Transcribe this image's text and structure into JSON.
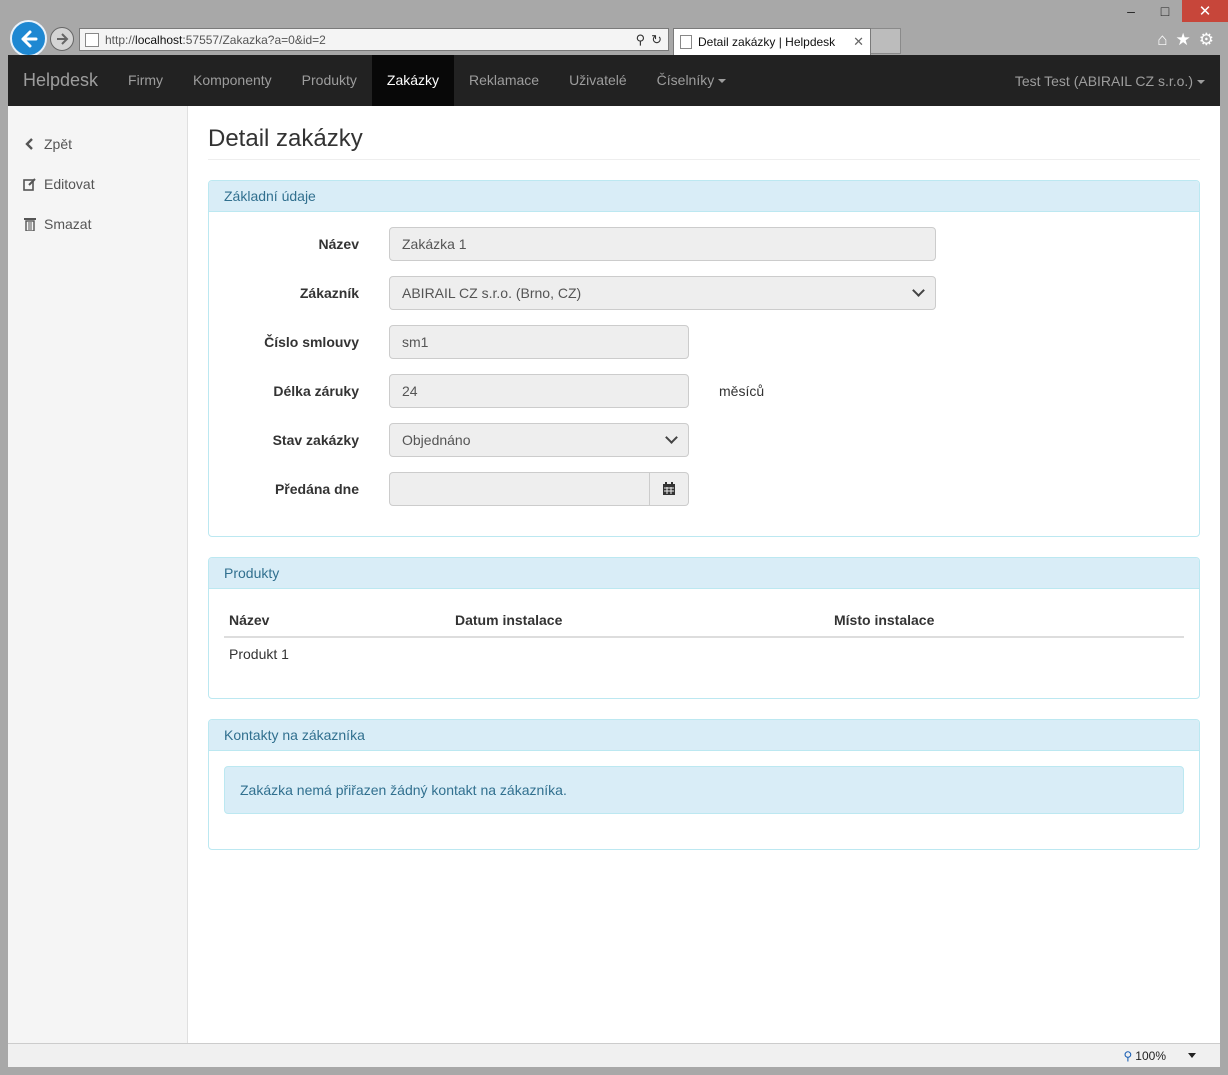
{
  "browser": {
    "url_prefix": "http://",
    "url_host": "localhost",
    "url_rest": ":57557/Zakazka?a=0&id=2",
    "tab_title": "Detail zakázky | Helpdesk",
    "zoom": "100%"
  },
  "navbar": {
    "brand": "Helpdesk",
    "items": [
      {
        "label": "Firmy"
      },
      {
        "label": "Komponenty"
      },
      {
        "label": "Produkty"
      },
      {
        "label": "Zakázky",
        "active": true
      },
      {
        "label": "Reklamace"
      },
      {
        "label": "Uživatelé"
      },
      {
        "label": "Číselníky"
      }
    ],
    "user": "Test Test (ABIRAIL CZ s.r.o.)"
  },
  "sidebar": {
    "back": "Zpět",
    "edit": "Editovat",
    "delete": "Smazat"
  },
  "page": {
    "title": "Detail zakázky"
  },
  "basic": {
    "heading": "Základní údaje",
    "name_label": "Název",
    "name_value": "Zakázka 1",
    "customer_label": "Zákazník",
    "customer_value": "ABIRAIL CZ s.r.o. (Brno, CZ)",
    "contract_label": "Číslo smlouvy",
    "contract_value": "sm1",
    "warranty_label": "Délka záruky",
    "warranty_value": "24",
    "warranty_unit": "měsíců",
    "state_label": "Stav zakázky",
    "state_value": "Objednáno",
    "handover_label": "Předána dne",
    "handover_value": ""
  },
  "products": {
    "heading": "Produkty",
    "columns": [
      "Název",
      "Datum instalace",
      "Místo instalace"
    ],
    "rows": [
      [
        "Produkt 1",
        "",
        ""
      ]
    ]
  },
  "contacts": {
    "heading": "Kontakty na zákazníka",
    "empty_message": "Zakázka nemá přiřazen žádný kontakt na zákazníka."
  }
}
